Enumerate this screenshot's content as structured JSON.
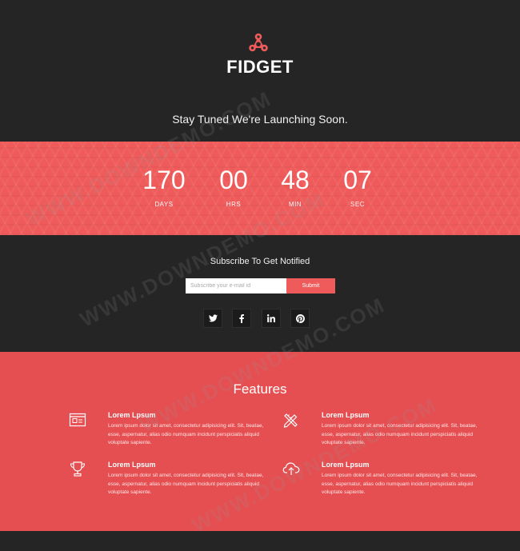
{
  "brand": {
    "name": "FIDGET",
    "tagline": "Stay Tuned We're Launching Soon.",
    "logo_icon": "fidget-spinner-icon"
  },
  "countdown": [
    {
      "value": "170",
      "label": "DAYS"
    },
    {
      "value": "00",
      "label": "HRS"
    },
    {
      "value": "48",
      "label": "MIN"
    },
    {
      "value": "07",
      "label": "SEC"
    }
  ],
  "subscribe": {
    "title": "Subscribe To Get Notified",
    "placeholder": "Subscribe your e-mail id",
    "button": "Submit",
    "social": [
      "twitter-icon",
      "facebook-icon",
      "linkedin-icon",
      "pinterest-icon"
    ]
  },
  "features": {
    "title": "Features",
    "items": [
      {
        "icon": "browser-window-icon",
        "title": "Lorem Lpsum",
        "text": "Lorem ipsum dolor sit amet, consectetur adipisicing elit. Sit, beatae, esse, aspernatur, alias odio numquam incidunt perspiciatis aliquid voluptate sapiente."
      },
      {
        "icon": "pencil-ruler-icon",
        "title": "Lorem Lpsum",
        "text": "Lorem ipsum dolor sit amet, consectetur adipisicing elit. Sit, beatae, esse, aspernatur, alias odio numquam incidunt perspiciatis aliquid voluptate sapiente."
      },
      {
        "icon": "trophy-icon",
        "title": "Lorem Lpsum",
        "text": "Lorem ipsum dolor sit amet, consectetur adipisicing elit. Sit, beatae, esse, aspernatur, alias odio numquam incidunt perspiciatis aliquid voluptate sapiente."
      },
      {
        "icon": "cloud-upload-icon",
        "title": "Lorem Lpsum",
        "text": "Lorem ipsum dolor sit amet, consectetur adipisicing elit. Sit, beatae, esse, aspernatur, alias odio numquam incidunt perspiciatis aliquid voluptate sapiente."
      }
    ]
  },
  "watermark": "WWW.DOWNDEMO.COM",
  "colors": {
    "dark": "#252525",
    "accent": "#ef5b5b",
    "features_bg": "#e54f52"
  }
}
